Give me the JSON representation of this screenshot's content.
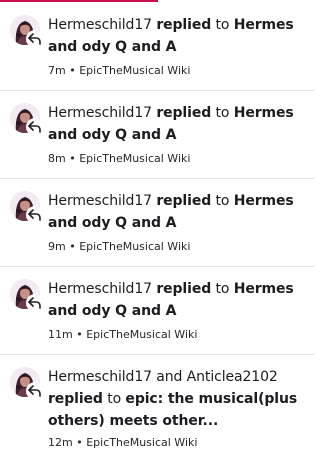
{
  "accent_color": "#c90e52",
  "notifications": [
    {
      "actor": "Hermeschild17",
      "verb": "replied",
      "connector": "to",
      "target": "Hermes and ody Q and A",
      "time": "7m",
      "separator": "•",
      "wiki": "EpicTheMusical Wiki",
      "avatar_icon": "user-avatar-icon",
      "badge_icon": "reply-arrow-icon"
    },
    {
      "actor": "Hermeschild17",
      "verb": "replied",
      "connector": "to",
      "target": "Hermes and ody Q and A",
      "time": "8m",
      "separator": "•",
      "wiki": "EpicTheMusical Wiki",
      "avatar_icon": "user-avatar-icon",
      "badge_icon": "reply-arrow-icon"
    },
    {
      "actor": "Hermeschild17",
      "verb": "replied",
      "connector": "to",
      "target": "Hermes and ody Q and A",
      "time": "9m",
      "separator": "•",
      "wiki": "EpicTheMusical Wiki",
      "avatar_icon": "user-avatar-icon",
      "badge_icon": "reply-arrow-icon"
    },
    {
      "actor": "Hermeschild17",
      "verb": "replied",
      "connector": "to",
      "target": "Hermes and ody Q and A",
      "time": "11m",
      "separator": "•",
      "wiki": "EpicTheMusical Wiki",
      "avatar_icon": "user-avatar-icon",
      "badge_icon": "reply-arrow-icon"
    },
    {
      "actor": "Hermeschild17 and Anticlea2102",
      "verb": "replied",
      "connector": "to",
      "target": "epic: the musical(plus others) meets other...",
      "time": "12m",
      "separator": "•",
      "wiki": "EpicTheMusical Wiki",
      "avatar_icon": "user-avatar-icon",
      "badge_icon": "reply-arrow-icon"
    }
  ]
}
